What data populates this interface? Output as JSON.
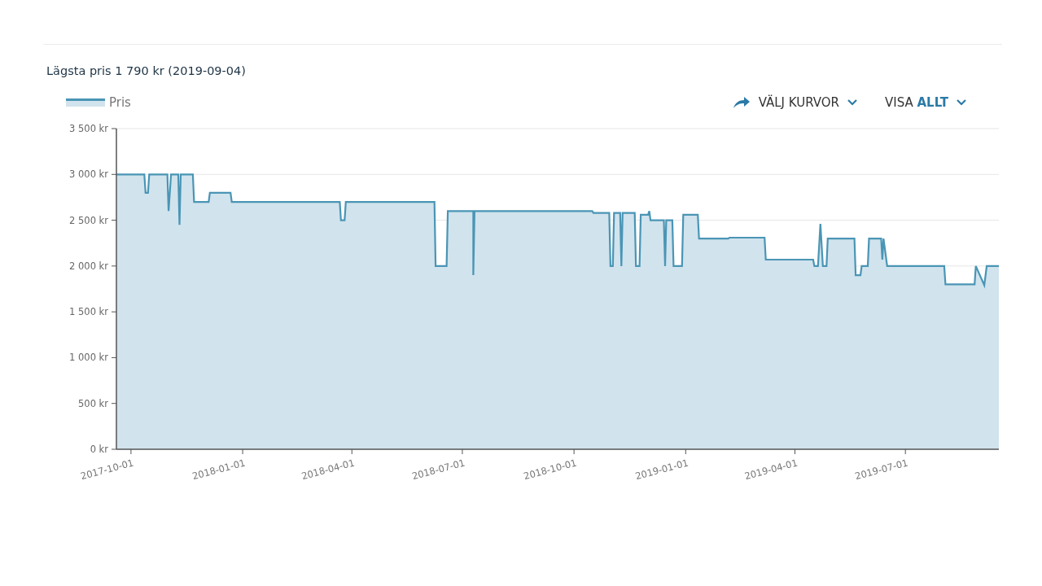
{
  "title": "Lägsta pris 1 790 kr (2019-09-04)",
  "curves_button": {
    "label": "VÄLJ KURVOR"
  },
  "view_select": {
    "label": "VISA",
    "value": "ALLT"
  },
  "chart_data": {
    "type": "area",
    "grid": true,
    "xlim": [
      "2017-09-19",
      "2019-09-16"
    ],
    "ylim": [
      0,
      3500
    ],
    "xticks": [
      "2017-10-01",
      "2018-01-01",
      "2018-04-01",
      "2018-07-01",
      "2018-10-01",
      "2019-01-01",
      "2019-04-01",
      "2019-07-01"
    ],
    "yticks": [
      {
        "value": 0,
        "label": "0 kr"
      },
      {
        "value": 500,
        "label": "500 kr"
      },
      {
        "value": 1000,
        "label": "1 000 kr"
      },
      {
        "value": 1500,
        "label": "1 500 kr"
      },
      {
        "value": 2000,
        "label": "2 000 kr"
      },
      {
        "value": 2500,
        "label": "2 500 kr"
      },
      {
        "value": 3000,
        "label": "3 000 kr"
      },
      {
        "value": 3500,
        "label": "3 500 kr"
      }
    ],
    "x": [
      "2017-09-19",
      "2017-10-12",
      "2017-10-13",
      "2017-10-15",
      "2017-10-16",
      "2017-10-31",
      "2017-11-01",
      "2017-11-03",
      "2017-11-09",
      "2017-11-10",
      "2017-11-11",
      "2017-11-21",
      "2017-11-22",
      "2017-12-04",
      "2017-12-05",
      "2017-12-22",
      "2017-12-23",
      "2018-03-22",
      "2018-03-23",
      "2018-03-26",
      "2018-03-27",
      "2018-06-08",
      "2018-06-09",
      "2018-06-18",
      "2018-06-19",
      "2018-07-10",
      "2018-07-10",
      "2018-07-11",
      "2018-10-16",
      "2018-10-17",
      "2018-10-30",
      "2018-10-31",
      "2018-11-02",
      "2018-11-03",
      "2018-11-08",
      "2018-11-09",
      "2018-11-10",
      "2018-11-20",
      "2018-11-21",
      "2018-11-24",
      "2018-11-25",
      "2018-12-01",
      "2018-12-02",
      "2018-12-03",
      "2018-12-14",
      "2018-12-15",
      "2018-12-16",
      "2018-12-21",
      "2018-12-22",
      "2018-12-29",
      "2018-12-30",
      "2019-01-11",
      "2019-01-12",
      "2019-02-05",
      "2019-02-06",
      "2019-03-07",
      "2019-03-08",
      "2019-04-16",
      "2019-04-17",
      "2019-04-20",
      "2019-04-22",
      "2019-04-24",
      "2019-04-27",
      "2019-04-28",
      "2019-05-20",
      "2019-05-21",
      "2019-05-25",
      "2019-05-26",
      "2019-05-31",
      "2019-06-01",
      "2019-06-11",
      "2019-06-12",
      "2019-06-13",
      "2019-06-16",
      "2019-08-02",
      "2019-08-03",
      "2019-08-27",
      "2019-08-28",
      "2019-09-04",
      "2019-09-06",
      "2019-09-16"
    ],
    "series": [
      {
        "name": "Pris",
        "color": "#4a95b5",
        "values": [
          3000,
          3000,
          2800,
          2800,
          3000,
          3000,
          2600,
          3000,
          3000,
          2450,
          3000,
          3000,
          2700,
          2700,
          2800,
          2800,
          2700,
          2700,
          2500,
          2500,
          2700,
          2700,
          2000,
          2000,
          2600,
          2600,
          1900,
          2600,
          2600,
          2580,
          2580,
          2000,
          2000,
          2580,
          2580,
          2000,
          2580,
          2580,
          2000,
          2000,
          2560,
          2560,
          2600,
          2500,
          2500,
          2000,
          2500,
          2500,
          2000,
          2000,
          2560,
          2560,
          2300,
          2300,
          2310,
          2310,
          2070,
          2070,
          2000,
          2000,
          2460,
          2000,
          2000,
          2300,
          2300,
          1900,
          1900,
          2000,
          2000,
          2300,
          2300,
          2070,
          2300,
          2000,
          2000,
          1800,
          1800,
          2000,
          1790,
          2000,
          2000
        ]
      }
    ]
  }
}
